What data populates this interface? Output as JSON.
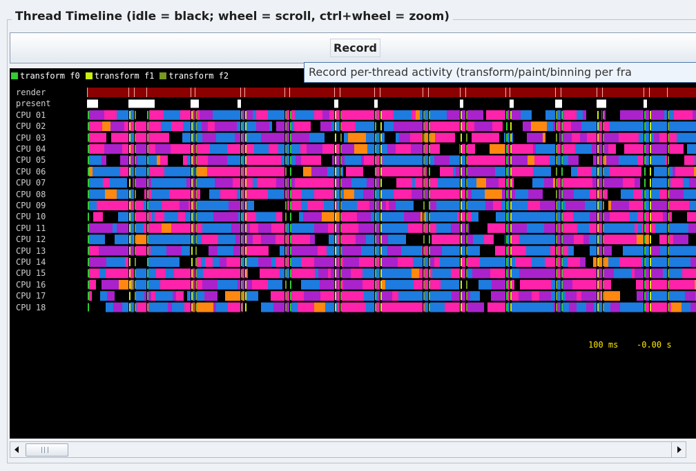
{
  "panel": {
    "title": "Thread Timeline (idle = black; wheel = scroll, ctrl+wheel = zoom)"
  },
  "record_button": {
    "label": "Record"
  },
  "tooltip": {
    "text": "Record per-thread activity (transform/paint/binning per fra"
  },
  "legend": [
    {
      "label": "transform f0",
      "color": "#33cc33"
    },
    {
      "label": "transform f1",
      "color": "#ccee11"
    },
    {
      "label": "transform f2",
      "color": "#779922"
    }
  ],
  "rows": [
    "render",
    "present",
    "CPU 01",
    "CPU 02",
    "CPU 03",
    "CPU 04",
    "CPU 05",
    "CPU 06",
    "CPU 07",
    "CPU 08",
    "CPU 09",
    "CPU 10",
    "CPU 11",
    "CPU 12",
    "CPU 13",
    "CPU 14",
    "CPU 15",
    "CPU 16",
    "CPU 17",
    "CPU 18"
  ],
  "track_colors": {
    "render": "#8b0000",
    "present": "#ffffff",
    "activity": [
      "#1e7be0",
      "#ff22aa",
      "#aa22cc",
      "#ff8811"
    ],
    "frame_markers": [
      "#33cc33",
      "#ccee11",
      "#779922"
    ],
    "idle": "#000000"
  },
  "readout": {
    "scale": "100 ms",
    "time": "-0.00 s"
  }
}
